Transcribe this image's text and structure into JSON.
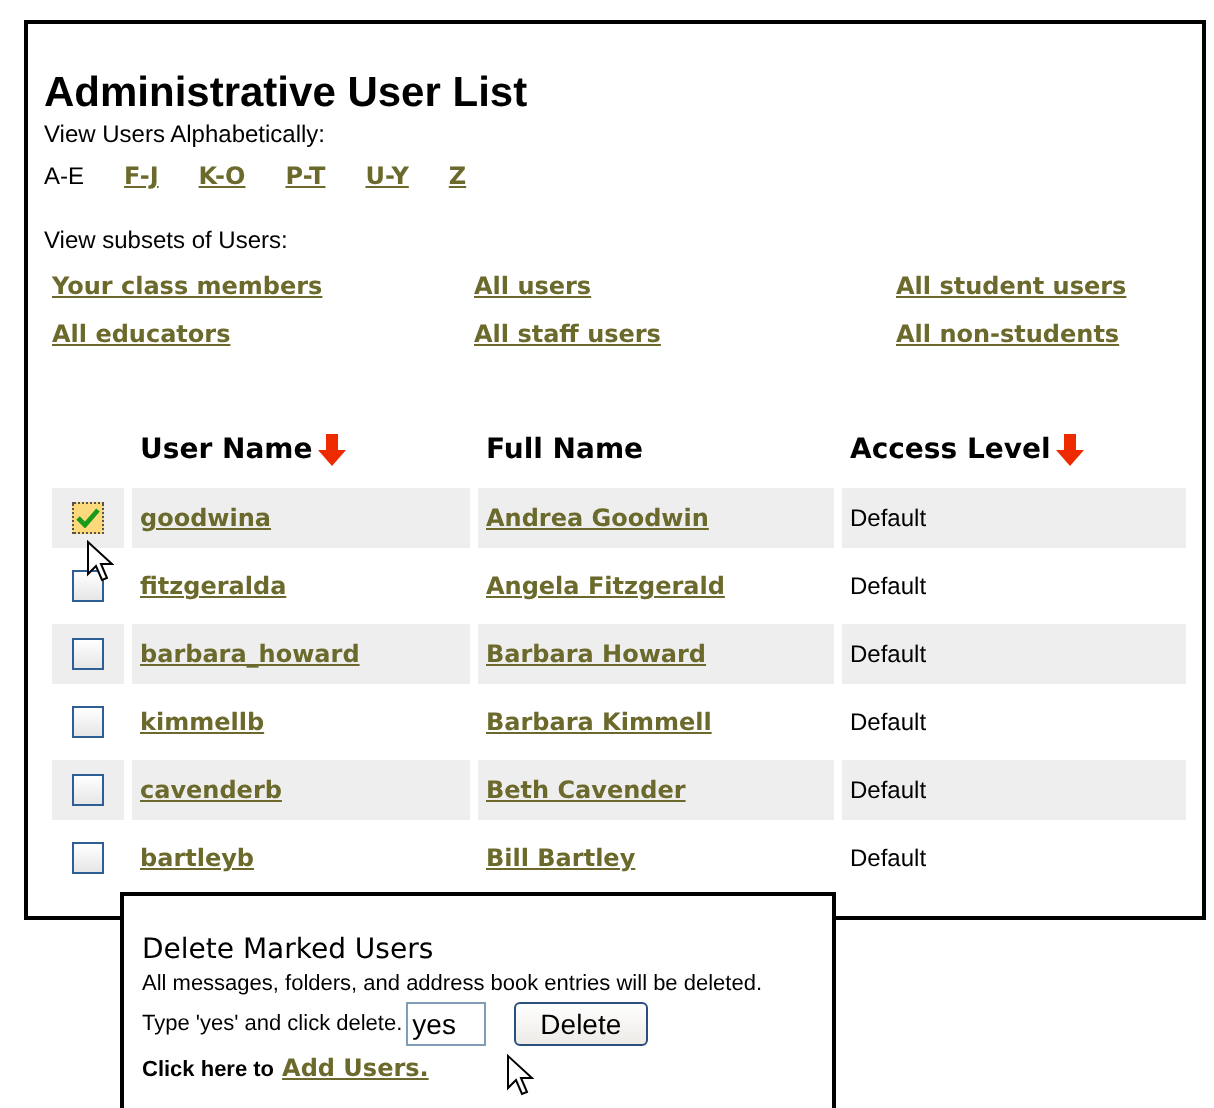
{
  "title": "Administrative User List",
  "alphabet": {
    "label": "View Users Alphabetically:",
    "letters": [
      {
        "text": "A-E",
        "selected": true
      },
      {
        "text": "F-J",
        "selected": false
      },
      {
        "text": "K-O",
        "selected": false
      },
      {
        "text": "P-T",
        "selected": false
      },
      {
        "text": "U-Y",
        "selected": false
      },
      {
        "text": "Z",
        "selected": false
      }
    ]
  },
  "subsets": {
    "label": "View subsets of Users:",
    "links": [
      "Your class members",
      "All users",
      "All student users",
      "All educators",
      "All staff users",
      "All non-students"
    ]
  },
  "table": {
    "columns": [
      {
        "label": "User Name",
        "sorted": true
      },
      {
        "label": "Full Name",
        "sorted": false
      },
      {
        "label": "Access Level",
        "sorted": true
      }
    ],
    "rows": [
      {
        "checked": true,
        "user_name": "goodwina",
        "full_name": "Andrea Goodwin",
        "access_level": "Default"
      },
      {
        "checked": false,
        "user_name": "fitzgeralda",
        "full_name": "Angela Fitzgerald",
        "access_level": "Default"
      },
      {
        "checked": false,
        "user_name": "barbara_howard",
        "full_name": "Barbara Howard",
        "access_level": "Default"
      },
      {
        "checked": false,
        "user_name": "kimmellb",
        "full_name": "Barbara Kimmell",
        "access_level": "Default"
      },
      {
        "checked": false,
        "user_name": "cavenderb",
        "full_name": "Beth Cavender",
        "access_level": "Default"
      },
      {
        "checked": false,
        "user_name": "bartleyb",
        "full_name": "Bill Bartley",
        "access_level": "Default"
      }
    ]
  },
  "delete_panel": {
    "title": "Delete Marked Users",
    "note": "All messages, folders, and address book entries will be deleted.",
    "prompt": "Type 'yes' and click delete.",
    "confirm_value": "yes",
    "button": "Delete",
    "footer": "Click here to",
    "footer_link": "Add Users."
  }
}
